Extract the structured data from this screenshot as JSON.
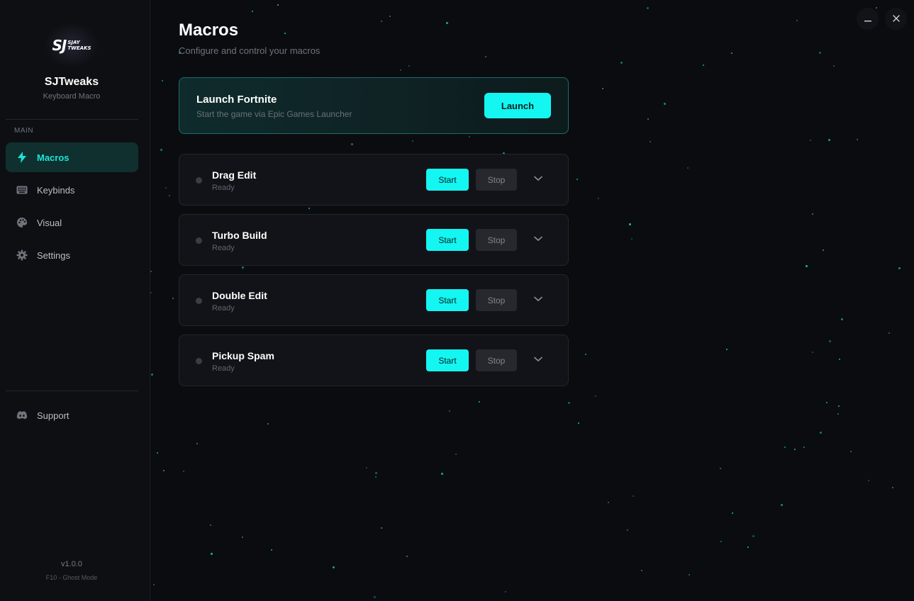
{
  "brand": {
    "logo_main": "SJ",
    "logo_line1": "SJAY",
    "logo_line2": "TWEAKS",
    "name": "SJTweaks",
    "subtitle": "Keyboard Macro"
  },
  "sidebar": {
    "section_label": "MAIN",
    "items": [
      {
        "label": "Macros",
        "icon": "bolt-icon",
        "active": true
      },
      {
        "label": "Keybinds",
        "icon": "keyboard-icon",
        "active": false
      },
      {
        "label": "Visual",
        "icon": "palette-icon",
        "active": false
      },
      {
        "label": "Settings",
        "icon": "gear-icon",
        "active": false
      }
    ],
    "support": {
      "label": "Support",
      "icon": "discord-icon"
    },
    "version": "v1.0.0",
    "hotkey_hint": "F10 - Ghost Mode"
  },
  "page": {
    "title": "Macros",
    "subtitle": "Configure and control your macros"
  },
  "launch": {
    "title": "Launch Fortnite",
    "subtitle": "Start the game via Epic Games Launcher",
    "button": "Launch"
  },
  "macros": [
    {
      "name": "Drag Edit",
      "status": "Ready",
      "start": "Start",
      "stop": "Stop"
    },
    {
      "name": "Turbo Build",
      "status": "Ready",
      "start": "Start",
      "stop": "Stop"
    },
    {
      "name": "Double Edit",
      "status": "Ready",
      "start": "Start",
      "stop": "Stop"
    },
    {
      "name": "Pickup Spam",
      "status": "Ready",
      "start": "Start",
      "stop": "Stop"
    }
  ],
  "window_controls": {
    "minimize": "minimize-icon",
    "close": "close-icon"
  },
  "colors": {
    "accent": "#14f6f2",
    "accent_text": "#1ce3d8",
    "background": "#0b0c10",
    "sidebar": "#0e0f13",
    "card": "#121318",
    "star": "#1bd8b5"
  }
}
